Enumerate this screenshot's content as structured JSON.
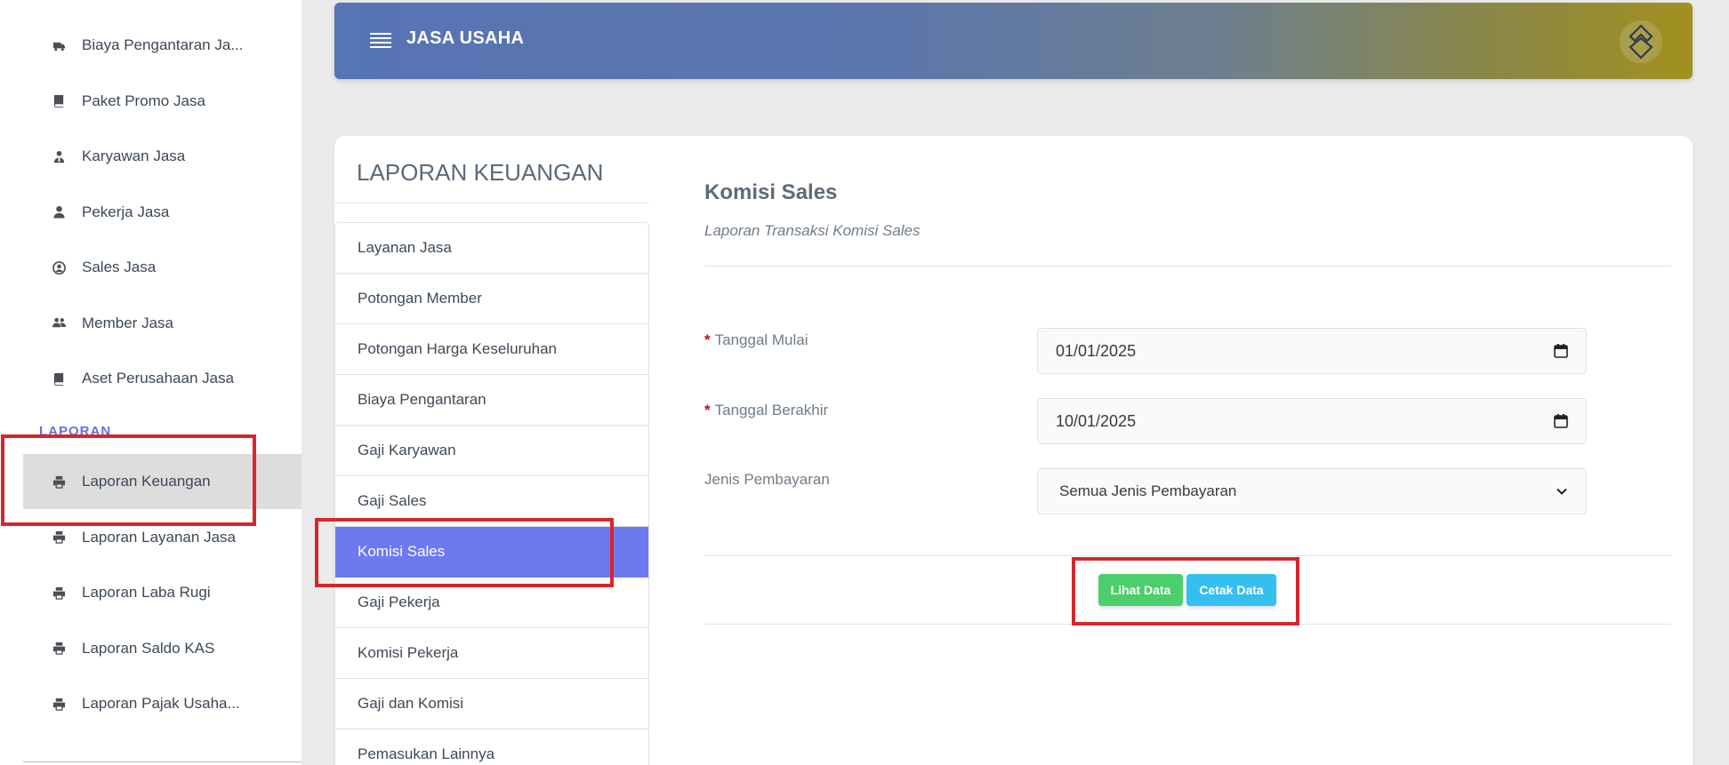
{
  "sidebar": {
    "items_top": [
      {
        "label": "Biaya Pengantaran Ja...",
        "icon": "truck-icon"
      },
      {
        "label": "Paket Promo Jasa",
        "icon": "book-icon"
      },
      {
        "label": "Karyawan Jasa",
        "icon": "user-tie-icon"
      },
      {
        "label": "Pekerja Jasa",
        "icon": "user-icon"
      },
      {
        "label": "Sales Jasa",
        "icon": "user-circle-icon"
      },
      {
        "label": "Member Jasa",
        "icon": "users-icon"
      },
      {
        "label": "Aset Perusahaan Jasa",
        "icon": "book-icon"
      }
    ],
    "heading": "LAPORAN",
    "items_bottom": [
      {
        "label": "Laporan Keuangan",
        "icon": "print-icon",
        "active": true
      },
      {
        "label": "Laporan Layanan Jasa",
        "icon": "print-icon"
      },
      {
        "label": "Laporan Laba Rugi",
        "icon": "print-icon"
      },
      {
        "label": "Laporan Saldo KAS",
        "icon": "print-icon"
      },
      {
        "label": "Laporan Pajak Usaha...",
        "icon": "print-icon"
      }
    ]
  },
  "header": {
    "title": "JASA USAHA"
  },
  "card": {
    "title": "LAPORAN KEUANGAN",
    "report_list": [
      "Layanan Jasa",
      "Potongan Member",
      "Potongan Harga Keseluruhan",
      "Biaya Pengantaran",
      "Gaji Karyawan",
      "Gaji Sales",
      "Komisi Sales",
      "Gaji Pekerja",
      "Komisi Pekerja",
      "Gaji dan Komisi",
      "Pemasukan Lainnya"
    ],
    "active_report": "Komisi Sales"
  },
  "section": {
    "title": "Komisi Sales",
    "subtitle": "Laporan Transaksi Komisi Sales"
  },
  "form": {
    "start_label": "Tanggal Mulai",
    "start_value": "01/01/2025",
    "end_label": "Tanggal Berakhir",
    "end_value": "10/01/2025",
    "payment_label": "Jenis Pembayaran",
    "payment_value": "Semua Jenis Pembayaran",
    "required_mark": "*"
  },
  "buttons": {
    "view": "Lihat Data",
    "print": "Cetak Data"
  },
  "colors": {
    "active_item": "#6d79ee",
    "btn_view": "#4ccf6a",
    "btn_print": "#35bff0",
    "highlight": "#d6272b"
  }
}
